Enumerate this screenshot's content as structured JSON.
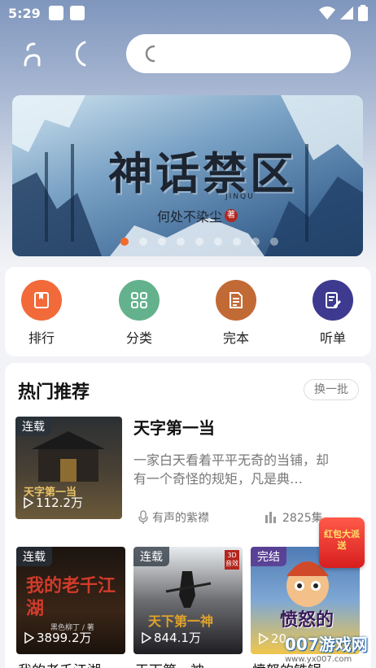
{
  "status": {
    "time": "5:29"
  },
  "banner": {
    "title": "神话禁区",
    "subtitle": "JINQU",
    "author": "何处不染尘",
    "author_seal": "著",
    "dots": 9,
    "active_dot": 0
  },
  "quick": [
    {
      "label": "排行",
      "icon": "bookmark-icon",
      "color": "#f26a3a"
    },
    {
      "label": "分类",
      "icon": "grid-icon",
      "color": "#63b28d"
    },
    {
      "label": "完本",
      "icon": "document-icon",
      "color": "#c26a36"
    },
    {
      "label": "听单",
      "icon": "edit-list-icon",
      "color": "#3d3a8f"
    }
  ],
  "hot": {
    "title": "热门推荐",
    "refresh_label": "换一批",
    "featured": {
      "badge": "连载",
      "count": "112.2万",
      "title": "天字第一当",
      "desc": "一家白天看着平平无奇的当铺，却有一个奇怪的规矩，凡是典…",
      "narrator": "有声的紫襟",
      "episodes": "2825集",
      "cover_text": "天字第一当"
    },
    "books": [
      {
        "badge": "连载",
        "count": "3899.2万",
        "title": "我的老千江湖",
        "cover_text": "我的老千江湖",
        "cover_sub": "黑色柳丁 / 著"
      },
      {
        "badge": "连载",
        "count": "844.1万",
        "title": "天下第一神",
        "cover_text": "天下第一神",
        "cover_tag": "3D音效"
      },
      {
        "badge": "完结",
        "count": "20",
        "title": "愤怒的铁锅",
        "cover_text": "愤怒的"
      }
    ],
    "promo_text": "红包大派送",
    "watermark": "007游戏网",
    "watermark_url": "www.yx007.com"
  }
}
